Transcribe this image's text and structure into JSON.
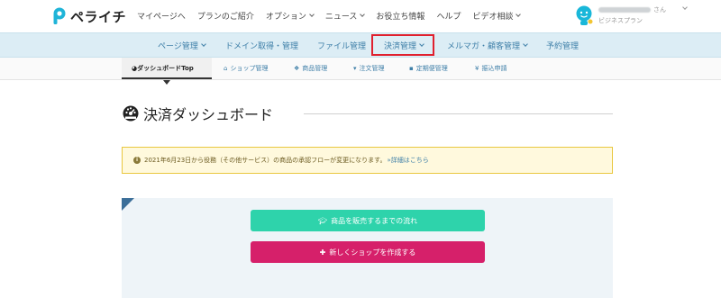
{
  "header": {
    "logo_text": "ペライチ",
    "nav": [
      {
        "label": "マイページへ",
        "dropdown": false
      },
      {
        "label": "プランのご紹介",
        "dropdown": false
      },
      {
        "label": "オプション",
        "dropdown": true
      },
      {
        "label": "ニュース",
        "dropdown": true
      },
      {
        "label": "お役立ち情報",
        "dropdown": false
      },
      {
        "label": "ヘルプ",
        "dropdown": false
      },
      {
        "label": "ビデオ相談",
        "dropdown": true
      }
    ],
    "user": {
      "honorific": "さん",
      "plan": "ビジネスプラン"
    }
  },
  "main_nav": {
    "items": [
      {
        "label": "ページ管理",
        "dropdown": true
      },
      {
        "label": "ドメイン取得・管理",
        "dropdown": false
      },
      {
        "label": "ファイル管理",
        "dropdown": false
      },
      {
        "label": "決済管理",
        "dropdown": true,
        "active": true
      },
      {
        "label": "メルマガ・顧客管理",
        "dropdown": true
      },
      {
        "label": "予約管理",
        "dropdown": false
      }
    ]
  },
  "sub_nav": {
    "items": [
      {
        "label": "ダッシュボードTop",
        "icon": "dashboard-icon",
        "active": true
      },
      {
        "label": "ショップ管理",
        "icon": "home-icon"
      },
      {
        "label": "商品管理",
        "icon": "cubes-icon"
      },
      {
        "label": "注文管理",
        "icon": "cart-icon"
      },
      {
        "label": "定期便管理",
        "icon": "truck-icon"
      },
      {
        "label": "振込申請",
        "icon": "yen-icon"
      }
    ]
  },
  "page": {
    "title": "決済ダッシュボード"
  },
  "notice": {
    "text": "2021年6月23日から役務（その他サービス）の商品の承認フローが変更になります。",
    "link": "»詳細はこちら"
  },
  "actions": {
    "flow_button": "商品を販売するまでの流れ",
    "create_shop_button": "新しくショップを作成する"
  },
  "colors": {
    "nav_bg": "#dcedf5",
    "link": "#3e7fa8",
    "highlight": "#e0202e",
    "notice_bg": "#fff9dd",
    "notice_border": "#e9c73f",
    "green_button": "#2ed3ab",
    "pink_button": "#d6206a"
  }
}
